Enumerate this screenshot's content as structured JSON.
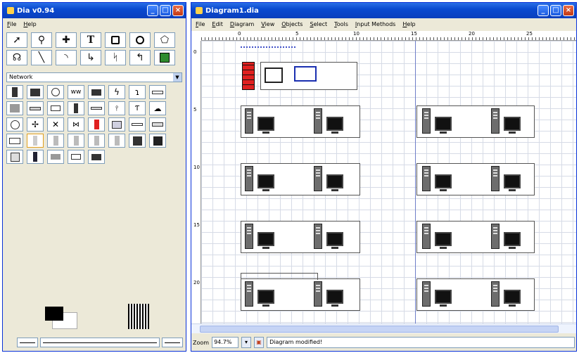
{
  "toolbox": {
    "title": "Dia v0.94",
    "menu": [
      "File",
      "Help"
    ],
    "sheet": "Network",
    "tools": [
      "pointer",
      "magnify",
      "scroll",
      "text",
      "box",
      "ellipse",
      "polygon",
      "beziergon",
      "line",
      "arc",
      "zigzag",
      "polyline",
      "bezier",
      "image"
    ]
  },
  "diagram": {
    "title": "Diagram1.dia",
    "menu": [
      "File",
      "Edit",
      "Diagram",
      "View",
      "Objects",
      "Select",
      "Tools",
      "Input Methods",
      "Help"
    ],
    "ruler_h": [
      "0",
      "5",
      "10",
      "15",
      "20",
      "25"
    ],
    "ruler_v": [
      "0",
      "5",
      "10",
      "15",
      "20"
    ],
    "zoom": "94.7%",
    "status": "Diagram modified!"
  },
  "colors": {
    "accent": "#0a4ad0",
    "grid": "#d6dbe6",
    "pagebreak": "#6f7fc8"
  }
}
